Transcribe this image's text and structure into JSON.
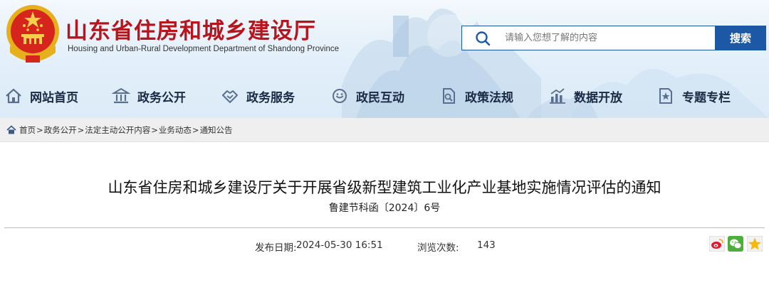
{
  "header": {
    "site_title": "山东省住房和城乡建设厅",
    "site_subtitle": "Housing and Urban-Rural Development Department of Shandong Province",
    "search": {
      "placeholder": "请输入您想了解的内容",
      "button_label": "搜索"
    }
  },
  "nav": {
    "items": [
      {
        "label": "网站首页",
        "icon": "home-icon"
      },
      {
        "label": "政务公开",
        "icon": "government-building-icon"
      },
      {
        "label": "政务服务",
        "icon": "handshake-icon"
      },
      {
        "label": "政民互动",
        "icon": "interaction-icon"
      },
      {
        "label": "政策法规",
        "icon": "document-icon"
      },
      {
        "label": "数据开放",
        "icon": "bar-chart-icon"
      },
      {
        "label": "专题专栏",
        "icon": "star-page-icon"
      }
    ]
  },
  "breadcrumb": {
    "items": [
      "首页",
      "政务公开",
      "法定主动公开内容",
      "业务动态",
      "通知公告"
    ],
    "separator": ">"
  },
  "article": {
    "title": "山东省住房和城乡建设厅关于开展省级新型建筑工业化产业基地实施情况评估的通知",
    "doc_number": "鲁建节科函〔2024〕6号",
    "publish_date_label": "发布日期:",
    "publish_date": "2024-05-30 16:51",
    "views_label": "浏览次数:",
    "views": "143"
  },
  "share": {
    "buttons": [
      "weibo-icon",
      "wechat-icon",
      "qzone-icon"
    ]
  },
  "colors": {
    "title_red": "#b8141c",
    "brand_blue": "#1d58a7",
    "nav_text": "#1a2a44"
  }
}
